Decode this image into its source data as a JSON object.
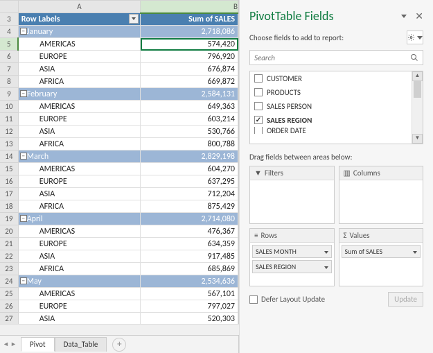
{
  "sheet": {
    "columns": [
      "A",
      "B"
    ],
    "header": {
      "a": "Row Labels",
      "b": "Sum of SALES"
    },
    "rows": [
      {
        "n": 3,
        "type": "header"
      },
      {
        "n": 4,
        "type": "month",
        "label": "January",
        "value": "2,718,086"
      },
      {
        "n": 5,
        "type": "detail",
        "label": "AMERICAS",
        "value": "574,420",
        "selected": true
      },
      {
        "n": 6,
        "type": "detail",
        "label": "EUROPE",
        "value": "796,920"
      },
      {
        "n": 7,
        "type": "detail",
        "label": "ASIA",
        "value": "676,874"
      },
      {
        "n": 8,
        "type": "detail",
        "label": "AFRICA",
        "value": "669,872"
      },
      {
        "n": 9,
        "type": "month",
        "label": "February",
        "value": "2,584,131"
      },
      {
        "n": 10,
        "type": "detail",
        "label": "AMERICAS",
        "value": "649,363"
      },
      {
        "n": 11,
        "type": "detail",
        "label": "EUROPE",
        "value": "603,214"
      },
      {
        "n": 12,
        "type": "detail",
        "label": "ASIA",
        "value": "530,766"
      },
      {
        "n": 13,
        "type": "detail",
        "label": "AFRICA",
        "value": "800,788"
      },
      {
        "n": 14,
        "type": "month",
        "label": "March",
        "value": "2,829,198"
      },
      {
        "n": 15,
        "type": "detail",
        "label": "AMERICAS",
        "value": "604,270"
      },
      {
        "n": 16,
        "type": "detail",
        "label": "EUROPE",
        "value": "637,295"
      },
      {
        "n": 17,
        "type": "detail",
        "label": "ASIA",
        "value": "712,204"
      },
      {
        "n": 18,
        "type": "detail",
        "label": "AFRICA",
        "value": "875,429"
      },
      {
        "n": 19,
        "type": "month",
        "label": "April",
        "value": "2,714,080"
      },
      {
        "n": 20,
        "type": "detail",
        "label": "AMERICAS",
        "value": "476,367"
      },
      {
        "n": 21,
        "type": "detail",
        "label": "EUROPE",
        "value": "634,359"
      },
      {
        "n": 22,
        "type": "detail",
        "label": "ASIA",
        "value": "917,485"
      },
      {
        "n": 23,
        "type": "detail",
        "label": "AFRICA",
        "value": "685,869"
      },
      {
        "n": 24,
        "type": "month",
        "label": "May",
        "value": "2,534,636"
      },
      {
        "n": 25,
        "type": "detail",
        "label": "AMERICAS",
        "value": "567,101"
      },
      {
        "n": 26,
        "type": "detail",
        "label": "EUROPE",
        "value": "797,027"
      },
      {
        "n": 27,
        "type": "detail",
        "label": "ASIA",
        "value": "520,303"
      }
    ],
    "tabs": {
      "active": "Pivot",
      "items": [
        "Pivot",
        "Data_Table"
      ]
    }
  },
  "pane": {
    "title": "PivotTable Fields",
    "choose": "Choose fields to add to report:",
    "search_placeholder": "Search",
    "fields": [
      {
        "label": "CUSTOMER",
        "checked": false
      },
      {
        "label": "PRODUCTS",
        "checked": false
      },
      {
        "label": "SALES PERSON",
        "checked": false
      },
      {
        "label": "SALES REGION",
        "checked": true,
        "bold": true
      },
      {
        "label": "ORDER DATE",
        "checked": false,
        "partial": true
      }
    ],
    "drag_label": "Drag fields between areas below:",
    "areas": {
      "filters": {
        "title": "Filters",
        "items": []
      },
      "columns": {
        "title": "Columns",
        "items": []
      },
      "rows": {
        "title": "Rows",
        "items": [
          "SALES MONTH",
          "SALES REGION"
        ]
      },
      "values": {
        "title": "Values",
        "items": [
          "Sum of SALES"
        ]
      }
    },
    "defer": "Defer Layout Update",
    "update": "Update"
  }
}
